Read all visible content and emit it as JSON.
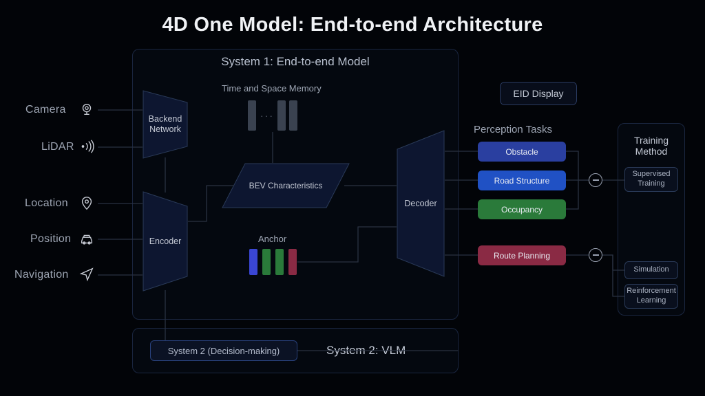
{
  "title": "4D One Model: End-to-end Architecture",
  "inputs": {
    "camera": "Camera",
    "lidar": "LiDAR",
    "location": "Location",
    "position": "Position",
    "navigation": "Navigation"
  },
  "system1": {
    "title": "System 1: End-to-end Model",
    "backend": "Backend\nNetwork",
    "encoder": "Encoder",
    "decoder": "Decoder",
    "memory": "Time and Space Memory",
    "bev": "BEV Characteristics",
    "anchor": "Anchor"
  },
  "system2": {
    "title": "System 2: VLM",
    "button": "System 2 (Decision-making)"
  },
  "right": {
    "eid": "EID Display",
    "perception_label": "Perception Tasks",
    "tasks": {
      "obstacle": "Obstacle",
      "road": "Road Structure",
      "occupancy": "Occupancy",
      "route": "Route Planning"
    }
  },
  "training": {
    "title": "Training\nMethod",
    "supervised": "Supervised\nTraining",
    "simulation": "Simulation",
    "rl": "Reinforcement\nLearning"
  },
  "colors": {
    "obstacle": "#2a3fa0",
    "road": "#2051c4",
    "occupancy": "#2a7a3a",
    "route": "#8a2a44",
    "anchor": [
      "#3a46d4",
      "#2a7a3a",
      "#2a7a3a",
      "#8a2a44"
    ]
  }
}
